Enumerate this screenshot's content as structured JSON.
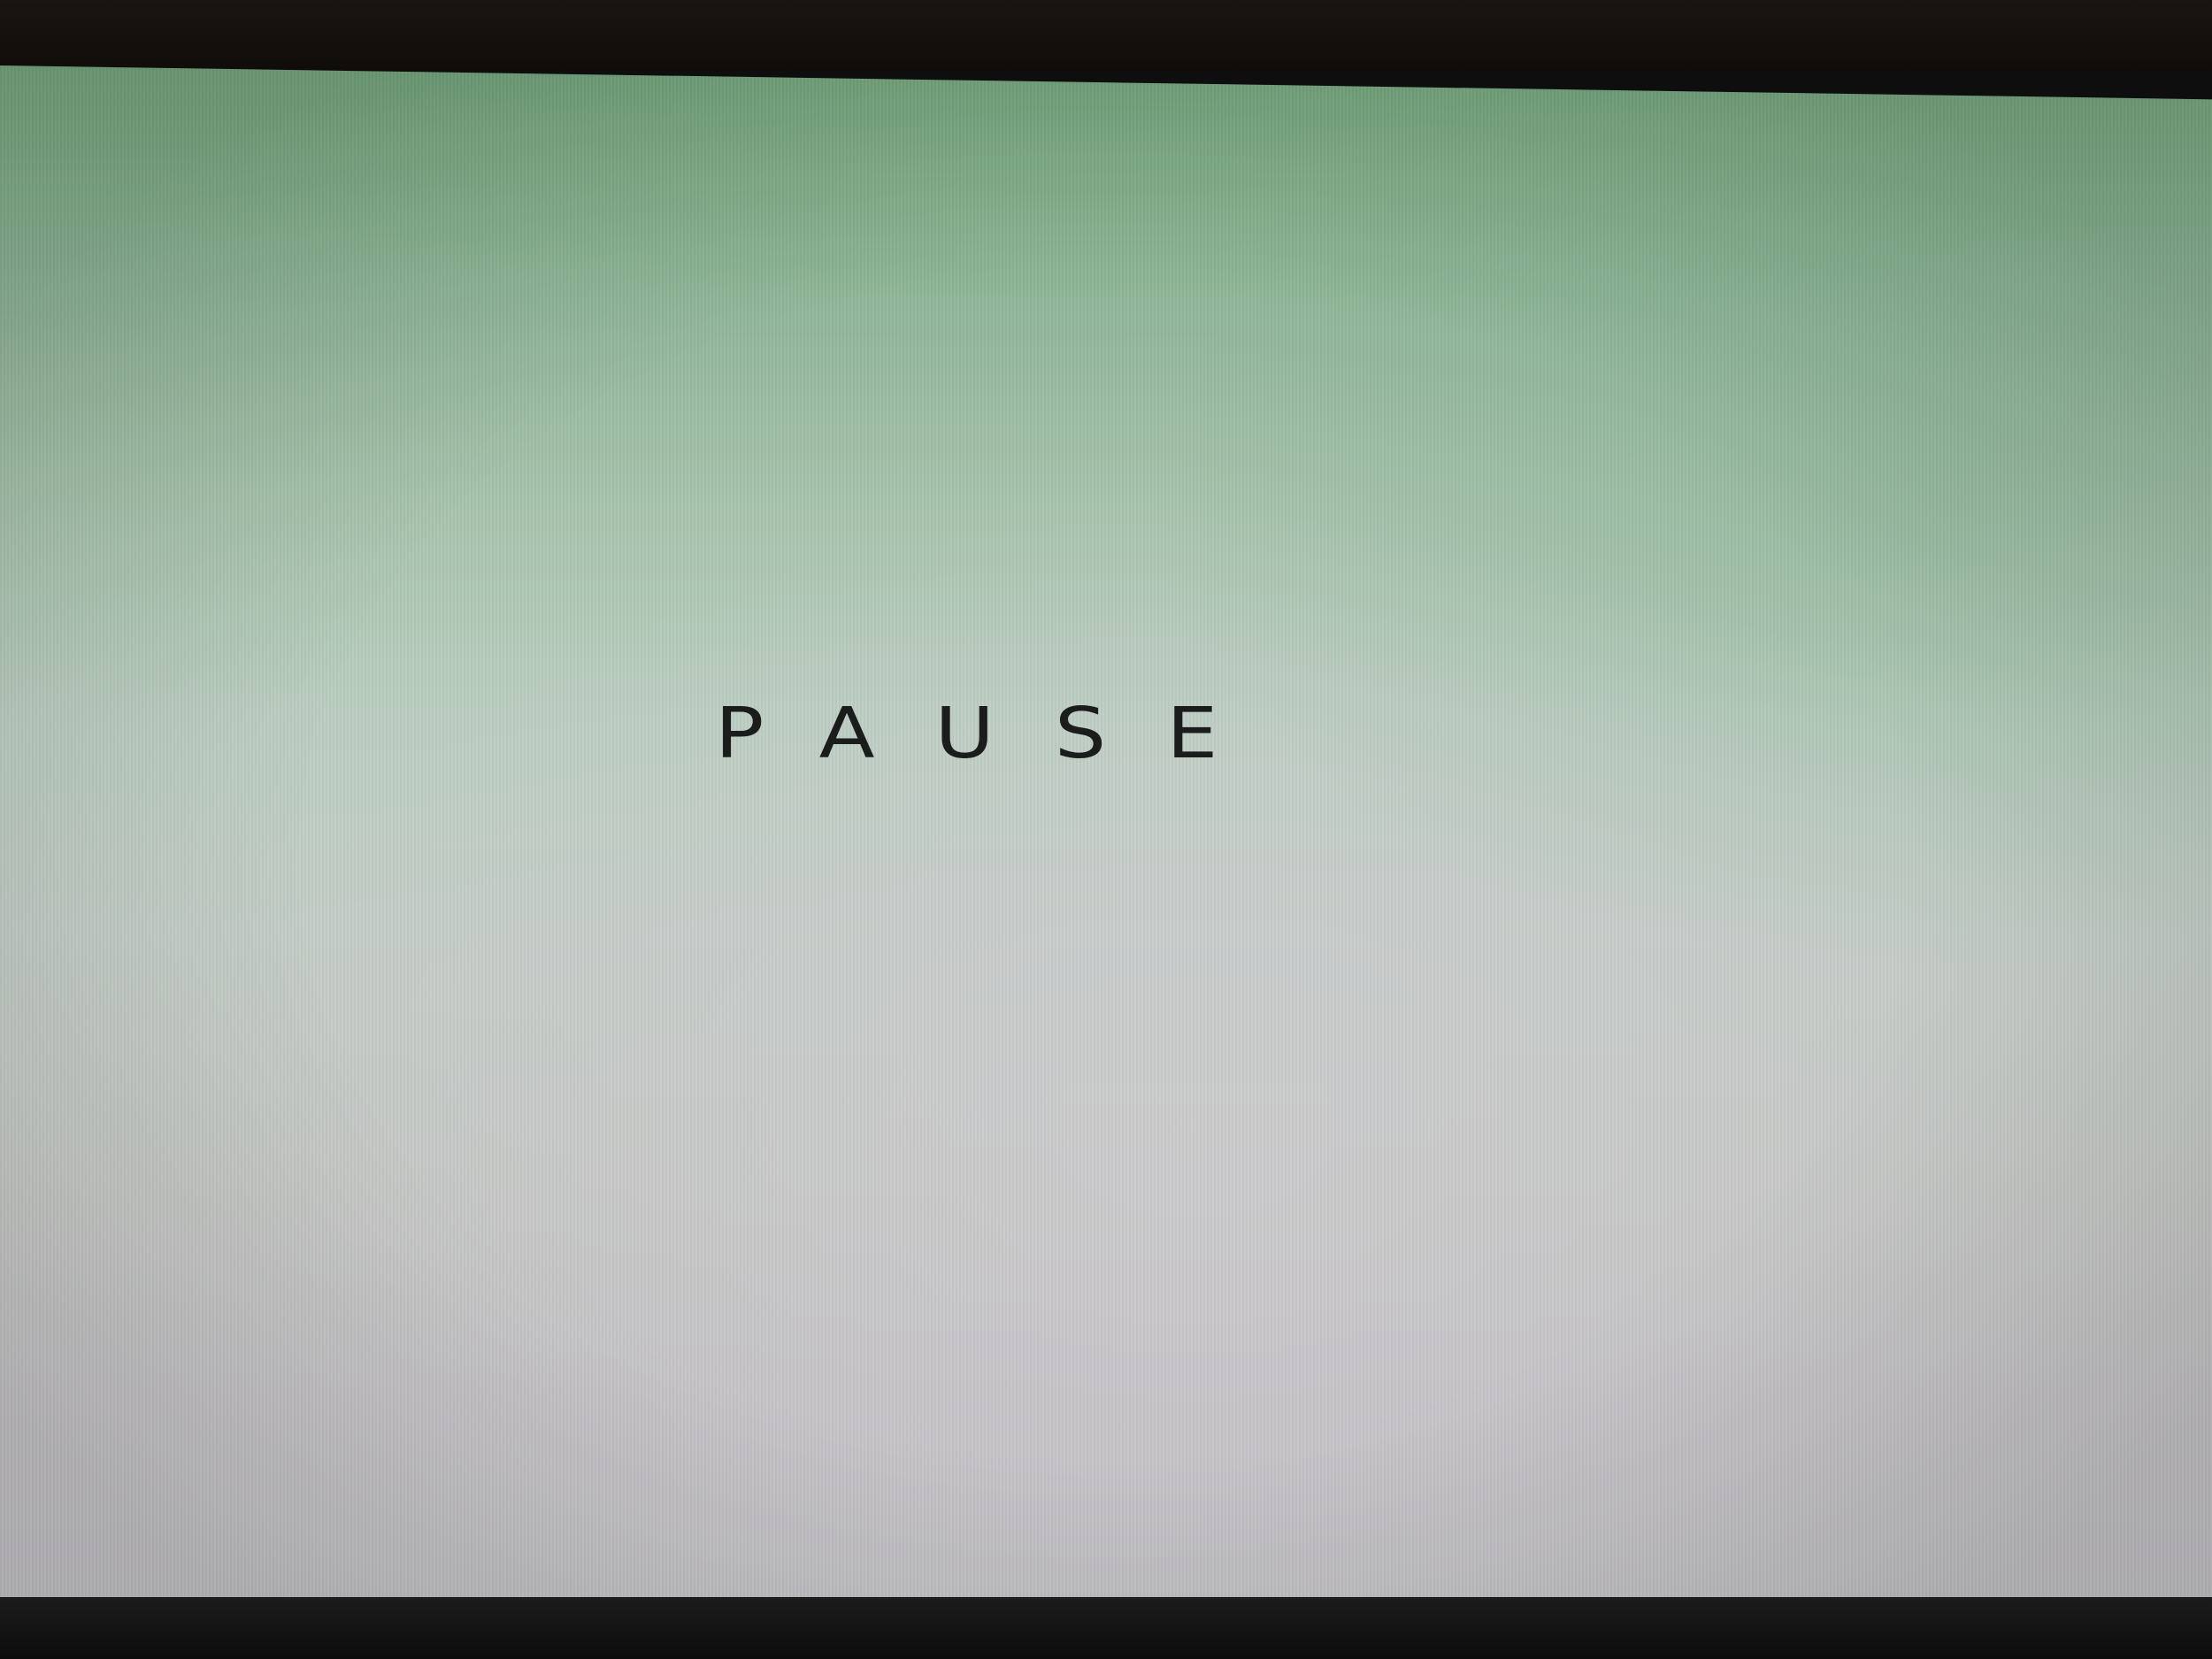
{
  "game": {
    "pause_text": "PAUSE"
  },
  "colors": {
    "screen_top": "#74a57d",
    "screen_bottom": "#c2c1c4",
    "text": "#1b1d1c",
    "bezel": "#0f0c0a"
  }
}
